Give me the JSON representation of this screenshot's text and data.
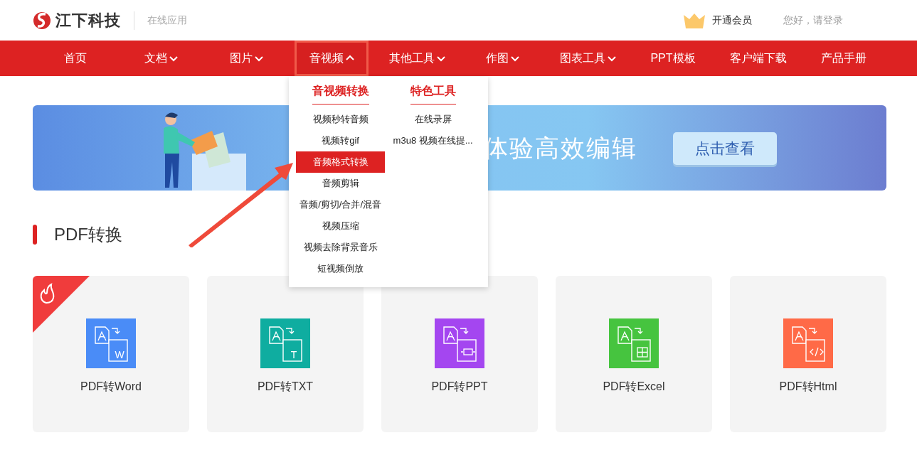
{
  "header": {
    "brand": "江下科技",
    "subtitle": "在线应用",
    "vip_link": "开通会员",
    "login_link": "您好，请登录"
  },
  "nav": [
    {
      "label": "首页",
      "dropdown": false,
      "selected": false
    },
    {
      "label": "文档",
      "dropdown": true,
      "expanded": false,
      "selected": false
    },
    {
      "label": "图片",
      "dropdown": true,
      "expanded": false,
      "selected": false
    },
    {
      "label": "音视频",
      "dropdown": true,
      "expanded": true,
      "selected": true
    },
    {
      "label": "其他工具",
      "dropdown": true,
      "expanded": false,
      "selected": false
    },
    {
      "label": "作图",
      "dropdown": true,
      "expanded": false,
      "selected": false
    },
    {
      "label": "图表工具",
      "dropdown": true,
      "expanded": false,
      "selected": false
    },
    {
      "label": "PPT模板",
      "dropdown": false,
      "selected": false
    },
    {
      "label": "客户端下载",
      "dropdown": false,
      "selected": false
    },
    {
      "label": "产品手册",
      "dropdown": false,
      "selected": false
    }
  ],
  "dropdown": {
    "columns": [
      {
        "heading": "音视频转换",
        "items": [
          {
            "label": "视频秒转音频",
            "selected": false
          },
          {
            "label": "视频转gif",
            "selected": false
          },
          {
            "label": "音频格式转换",
            "selected": true
          },
          {
            "label": "音频剪辑",
            "selected": false
          },
          {
            "label": "音频/剪切/合并/混音",
            "selected": false
          },
          {
            "label": "视频压缩",
            "selected": false
          },
          {
            "label": "视频去除背景音乐",
            "selected": false
          },
          {
            "label": "短视频倒放",
            "selected": false
          }
        ]
      },
      {
        "heading": "特色工具",
        "items": [
          {
            "label": "在线录屏",
            "selected": false
          },
          {
            "label": "m3u8 视频在线提...",
            "selected": false
          }
        ]
      }
    ]
  },
  "banner": {
    "headline": "体验高效编辑",
    "button": "点击查看"
  },
  "section": {
    "title": "PDF转换"
  },
  "cards": [
    {
      "label": "PDF转Word",
      "color": "#4a8cf7",
      "hot": true,
      "kind": "letter",
      "icon_text": "W"
    },
    {
      "label": "PDF转TXT",
      "color": "#0fada0",
      "hot": false,
      "kind": "letter",
      "icon_text": "T"
    },
    {
      "label": "PDF转PPT",
      "color": "#a446f0",
      "hot": false,
      "kind": "slides"
    },
    {
      "label": "PDF转Excel",
      "color": "#46c43f",
      "hot": false,
      "kind": "table"
    },
    {
      "label": "PDF转Html",
      "color": "#ff6a47",
      "hot": false,
      "kind": "code"
    }
  ]
}
